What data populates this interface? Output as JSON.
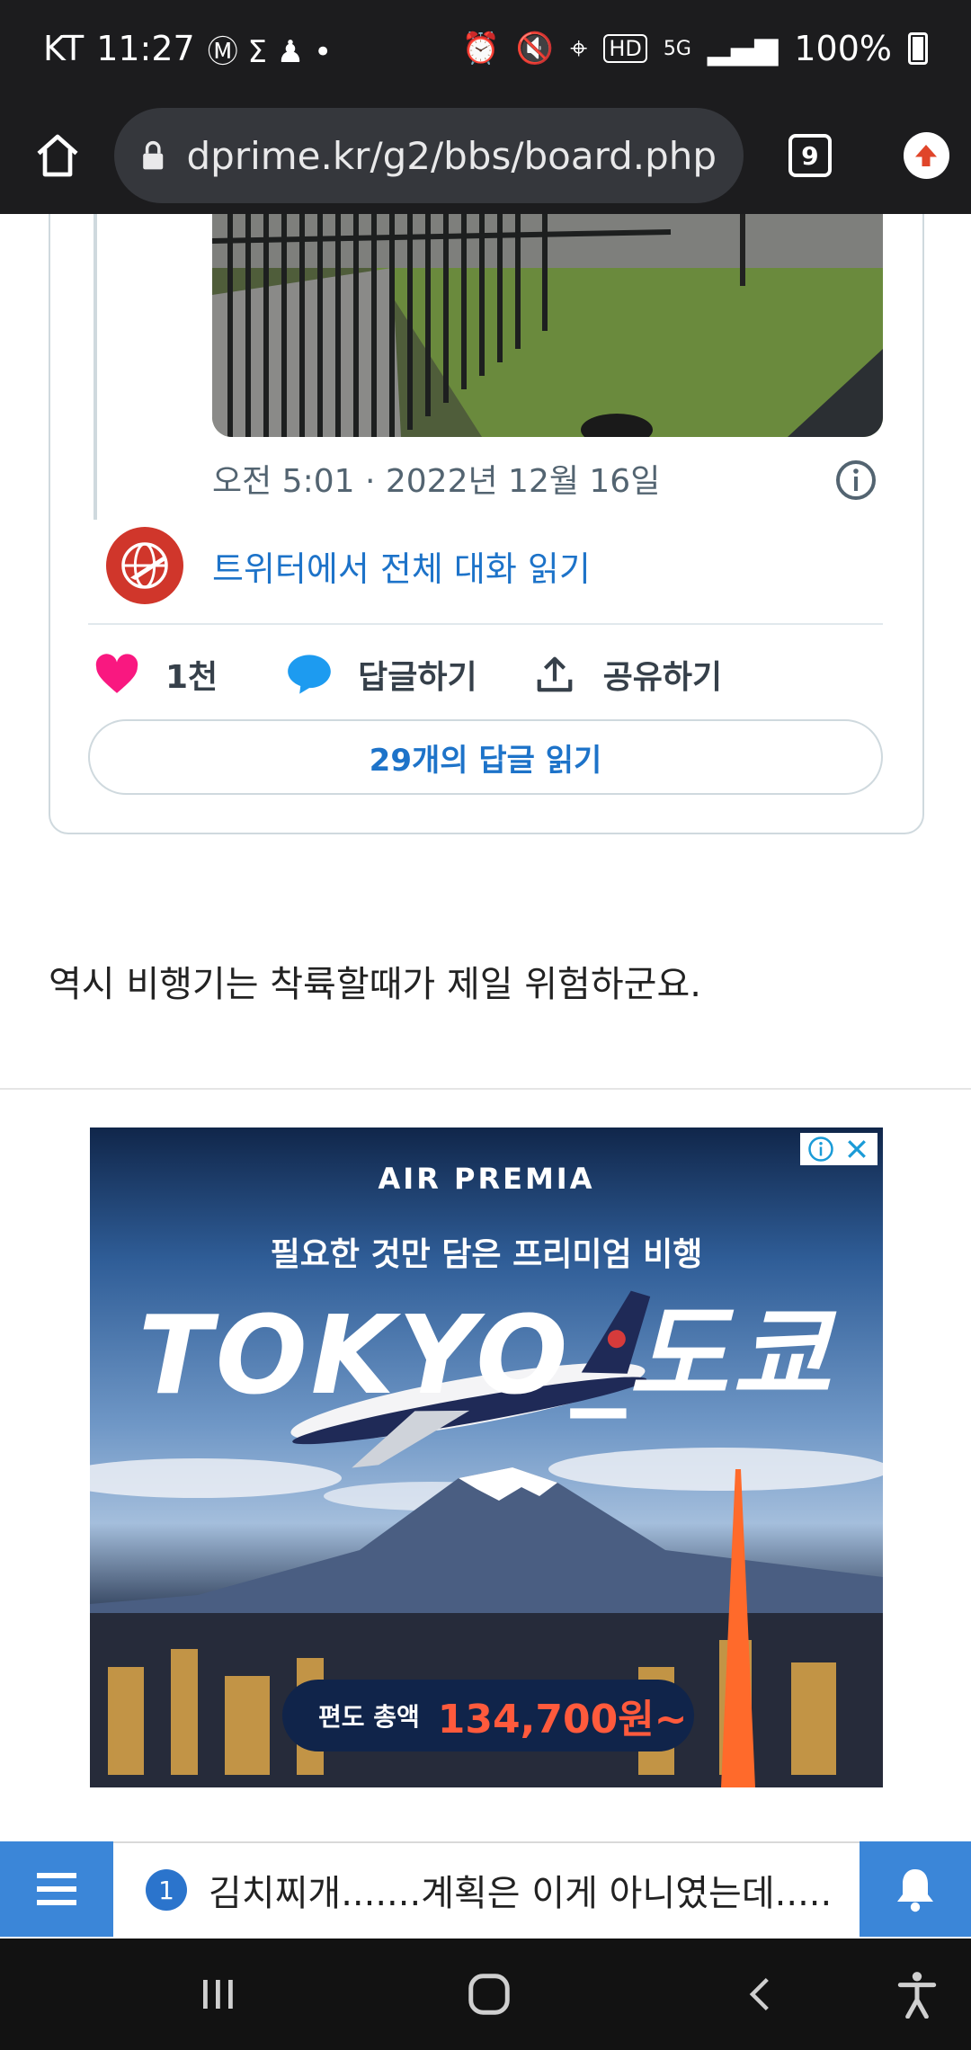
{
  "status_bar": {
    "carrier": "KT",
    "time": "11:27",
    "network": "5G",
    "battery": "100%"
  },
  "browser": {
    "url": "dprime.kr/g2/bbs/board.php",
    "tab_count": "9"
  },
  "tweet": {
    "timestamp": "오전 5:01 · 2022년 12월 16일",
    "read_conversation": "트위터에서 전체 대화 읽기",
    "likes": "1천",
    "reply_label": "답글하기",
    "share_label": "공유하기",
    "read_replies": "29개의 답글 읽기"
  },
  "post": {
    "body": "역시 비행기는 착륙할때가 제일 위험하군요."
  },
  "ad": {
    "brand": "AIR PREMIA",
    "headline": "필요한 것만 담은 프리미엄 비행",
    "destination": "TOKYO_도쿄",
    "price_label": "편도 총액",
    "price": "134,700원~"
  },
  "bottom_bar": {
    "notice_number": "1",
    "notice_text": "김치찌개.......계획은 이게 아니였는데....."
  },
  "colors": {
    "link_blue": "#1d73c9",
    "heart_pink": "#f91880",
    "bar_blue": "#3b86d8",
    "price_orange": "#ff5a3c"
  }
}
